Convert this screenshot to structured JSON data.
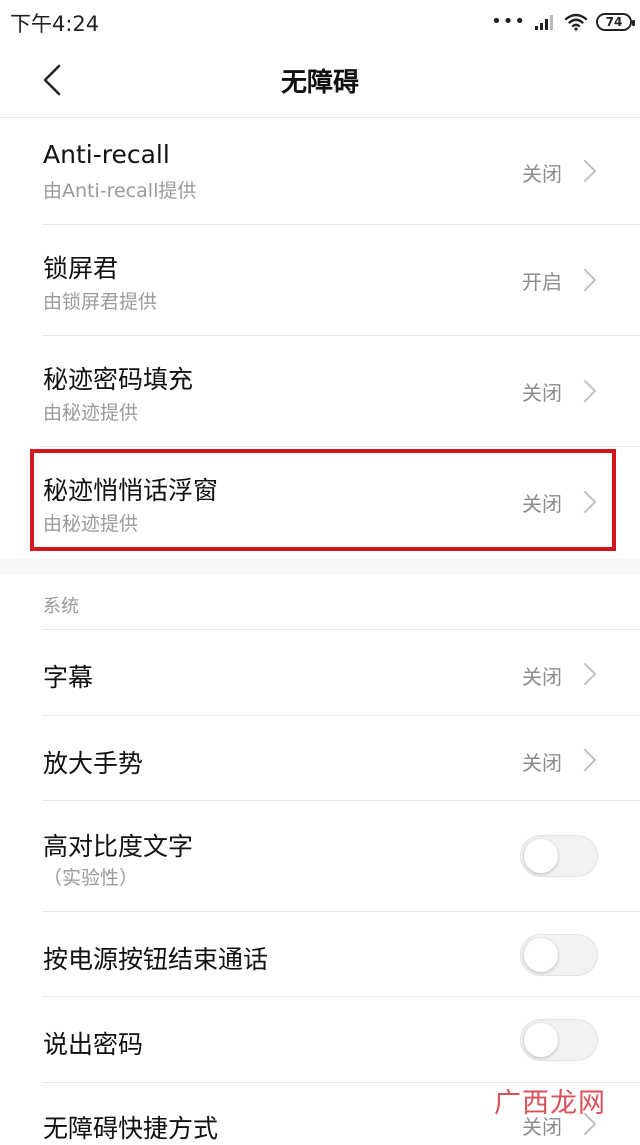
{
  "status_bar": {
    "time": "下午4:24",
    "battery": "74",
    "icons": [
      "more-dots-icon",
      "signal-icon",
      "wifi-icon",
      "battery-icon"
    ]
  },
  "header": {
    "title": "无障碍",
    "back_icon": "chevron-left-icon"
  },
  "services": [
    {
      "title": "Anti-recall",
      "subtitle": "由Anti-recall提供",
      "value": "关闭"
    },
    {
      "title": "锁屏君",
      "subtitle": "由锁屏君提供",
      "value": "开启"
    },
    {
      "title": "秘迹密码填充",
      "subtitle": "由秘迹提供",
      "value": "关闭"
    },
    {
      "title": "秘迹悄悄话浮窗",
      "subtitle": "由秘迹提供",
      "value": "关闭"
    }
  ],
  "system_section": {
    "label": "系统",
    "items": [
      {
        "title": "字幕",
        "value": "关闭"
      },
      {
        "title": "放大手势",
        "value": "关闭"
      },
      {
        "title": "高对比度文字",
        "subtitle": "（实验性）",
        "toggle": false
      },
      {
        "title": "按电源按钮结束通话",
        "toggle": false
      },
      {
        "title": "说出密码",
        "toggle": false
      },
      {
        "title": "无障碍快捷方式",
        "value": "关闭"
      }
    ]
  },
  "watermark": "广西龙网",
  "colors": {
    "highlight": "#d0181e",
    "watermark": "#d6323a",
    "secondary_text": "#9a9a9a"
  }
}
